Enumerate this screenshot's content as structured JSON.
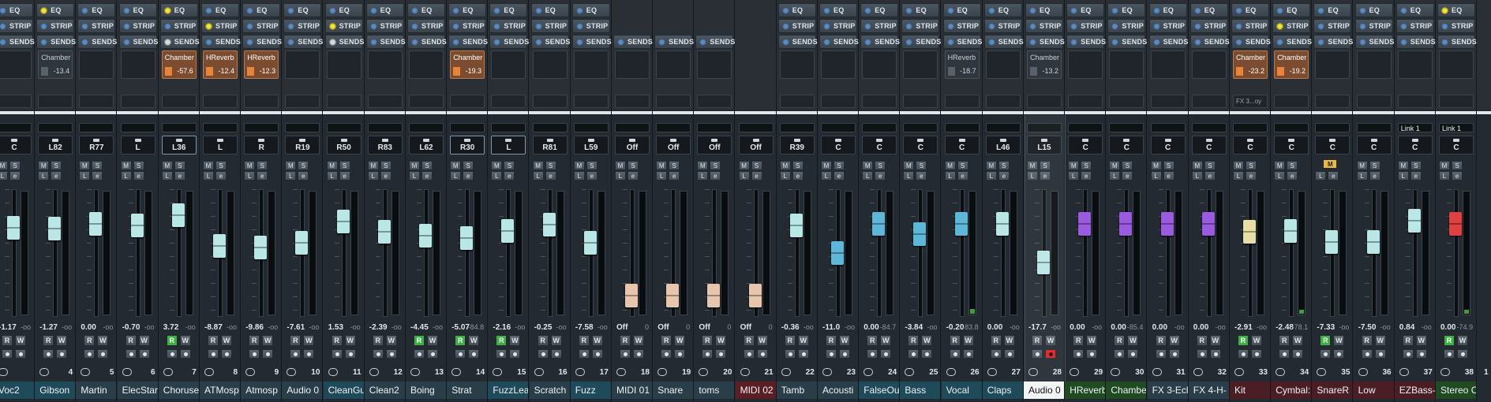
{
  "header_labels": {
    "eq": "EQ",
    "strip": "STRIP",
    "sends": "SENDS"
  },
  "channels": [
    {
      "eq": "blue",
      "strip": "blue",
      "sends": "blue",
      "send": null,
      "pan": "C",
      "rw": [
        "R",
        "W"
      ],
      "val": "-1.17",
      "peak": "-oo",
      "num": "",
      "name": "Voc2",
      "nameColor": "#1e4a5a",
      "faderColor": "#b9e7e6",
      "faderPos": 0.26
    },
    {
      "eq": "yellow",
      "strip": "blue",
      "sends": "blue",
      "send": {
        "name": "Chamber",
        "val": "-13.4",
        "style": "plain"
      },
      "pan": "L82",
      "val": "-1.27",
      "peak": "-oo",
      "num": "4",
      "name": "Gibson",
      "nameColor": "#1e4a5a",
      "faderColor": "#b9e7e6",
      "faderPos": 0.27
    },
    {
      "eq": "blue",
      "strip": "blue",
      "sends": "blue",
      "send": null,
      "pan": "R77",
      "val": "0.00",
      "peak": "-oo",
      "num": "5",
      "name": "Martin",
      "nameColor": "#2a3e4a",
      "faderColor": "#b9e7e6",
      "faderPos": 0.22
    },
    {
      "eq": "blue",
      "strip": "blue",
      "sends": "blue",
      "send": null,
      "pan": "L",
      "val": "-0.70",
      "peak": "-oo",
      "num": "6",
      "name": "ElecStar",
      "nameColor": "#2a3e4a",
      "faderColor": "#b9e7e6",
      "faderPos": 0.24
    },
    {
      "eq": "yellow",
      "strip": "blue",
      "sends": "off",
      "send": {
        "name": "Chamber",
        "val": "-57.6",
        "style": "orange"
      },
      "pan": "L36",
      "panSel": true,
      "val": "3.72",
      "peak": "-oo",
      "num": "7",
      "name": "Choruse",
      "nameColor": "#2a3e4a",
      "faderColor": "#b9e7e6",
      "faderPos": 0.14,
      "rOn": true
    },
    {
      "eq": "blue",
      "strip": "yellow",
      "sends": "blue",
      "send": {
        "name": "HReverb",
        "val": "-12.4",
        "style": "orange"
      },
      "pan": "L",
      "val": "-8.87",
      "peak": "-oo",
      "num": "8",
      "name": "ATMosp",
      "nameColor": "#2a3e4a",
      "faderColor": "#b9e7e6",
      "faderPos": 0.44
    },
    {
      "eq": "blue",
      "strip": "blue",
      "sends": "blue",
      "send": {
        "name": "HReverb",
        "val": "-12.3",
        "style": "orange"
      },
      "pan": "R",
      "val": "-9.86",
      "peak": "-oo",
      "num": "9",
      "name": "Atmosp",
      "nameColor": "#2a3e4a",
      "faderColor": "#b9e7e6",
      "faderPos": 0.45
    },
    {
      "eq": "blue",
      "strip": "blue",
      "sends": "blue",
      "send": null,
      "pan": "R19",
      "val": "-7.61",
      "peak": "-oo",
      "num": "10",
      "name": "Audio 0",
      "nameColor": "#2a3e4a",
      "faderColor": "#b9e7e6",
      "faderPos": 0.41
    },
    {
      "eq": "blue",
      "strip": "yellow",
      "sends": "off",
      "send": null,
      "pan": "R50",
      "val": "1.53",
      "peak": "-oo",
      "num": "11",
      "name": "CleanGu",
      "nameColor": "#1e4a5a",
      "faderColor": "#b9e7e6",
      "faderPos": 0.2
    },
    {
      "eq": "blue",
      "strip": "blue",
      "sends": "blue",
      "send": null,
      "pan": "R83",
      "val": "-2.39",
      "peak": "-oo",
      "num": "12",
      "name": "Clean2",
      "nameColor": "#2a3e4a",
      "faderColor": "#b9e7e6",
      "faderPos": 0.3
    },
    {
      "eq": "blue",
      "strip": "blue",
      "sends": "blue",
      "send": null,
      "pan": "L62",
      "val": "-4.45",
      "peak": "-oo",
      "num": "13",
      "name": "Boing",
      "nameColor": "#2a3e4a",
      "faderColor": "#b9e7e6",
      "faderPos": 0.34,
      "rOn": true
    },
    {
      "eq": "blue",
      "strip": "blue",
      "sends": "blue",
      "send": {
        "name": "Chamber",
        "val": "-19.3",
        "style": "orange"
      },
      "pan": "R30",
      "panSel": true,
      "val": "-5.07",
      "peak": "-84.8",
      "num": "14",
      "name": "Strat",
      "nameColor": "#2a3e4a",
      "faderColor": "#b9e7e6",
      "faderPos": 0.36,
      "rOn": true
    },
    {
      "eq": "blue",
      "strip": "blue",
      "sends": "blue",
      "send": null,
      "pan": "L",
      "panSel": true,
      "val": "-2.16",
      "peak": "-oo",
      "num": "15",
      "name": "FuzzLea",
      "nameColor": "#1e4a5a",
      "faderColor": "#b9e7e6",
      "faderPos": 0.29,
      "rOn": true
    },
    {
      "eq": "blue",
      "strip": "blue",
      "sends": "blue",
      "send": null,
      "pan": "R81",
      "val": "-0.25",
      "peak": "-oo",
      "num": "16",
      "name": "Scratch",
      "nameColor": "#2a3e4a",
      "faderColor": "#b9e7e6",
      "faderPos": 0.23
    },
    {
      "eq": "blue",
      "strip": "blue",
      "sends": "blue",
      "send": null,
      "pan": "L59",
      "val": "-7.58",
      "peak": "-oo",
      "num": "17",
      "name": "Fuzz",
      "nameColor": "#1e4a5a",
      "faderColor": "#b9e7e6",
      "faderPos": 0.41
    },
    {
      "eq": "",
      "strip": "",
      "sends": "blue",
      "send": null,
      "pan": "Off",
      "val": "Off",
      "peak": "0",
      "num": "18",
      "name": "MIDI 01",
      "nameColor": "#2a3e4a",
      "faderColor": "#e8c6ad",
      "faderPos": 0.92
    },
    {
      "eq": "",
      "strip": "",
      "sends": "blue",
      "send": null,
      "pan": "Off",
      "val": "Off",
      "peak": "0",
      "num": "19",
      "name": "Snare",
      "nameColor": "#2a3e4a",
      "faderColor": "#e8c6ad",
      "faderPos": 0.92
    },
    {
      "eq": "",
      "strip": "",
      "sends": "blue",
      "send": null,
      "pan": "Off",
      "val": "Off",
      "peak": "0",
      "num": "20",
      "name": "toms",
      "nameColor": "#2a3e4a",
      "faderColor": "#e8c6ad",
      "faderPos": 0.92
    },
    {
      "eq": "",
      "strip": "",
      "sends": "",
      "send": null,
      "pan": "Off",
      "val": "Off",
      "peak": "0",
      "num": "21",
      "name": "MIDI 02",
      "nameColor": "#5a1e24",
      "faderColor": "#e8c6ad",
      "faderPos": 0.92
    },
    {
      "eq": "blue",
      "strip": "blue",
      "sends": "blue",
      "send": null,
      "pan": "R39",
      "val": "-0.36",
      "peak": "-oo",
      "num": "22",
      "name": "Tamb",
      "nameColor": "#2a3e4a",
      "faderColor": "#b9e7e6",
      "faderPos": 0.24
    },
    {
      "eq": "blue",
      "strip": "blue",
      "sends": "blue",
      "send": null,
      "pan": "C",
      "val": "-11.0",
      "peak": "-oo",
      "num": "23",
      "name": "Acousti",
      "nameColor": "#2a3e4a",
      "faderColor": "#5db7d8",
      "faderPos": 0.51
    },
    {
      "eq": "blue",
      "strip": "blue",
      "sends": "blue",
      "send": null,
      "pan": "C",
      "val": "0.00",
      "peak": "-84.7",
      "num": "24",
      "name": "FalseOu",
      "nameColor": "#1e4a5a",
      "faderColor": "#5db7d8",
      "faderPos": 0.22
    },
    {
      "eq": "blue",
      "strip": "blue",
      "sends": "blue",
      "send": null,
      "pan": "C",
      "val": "-3.84",
      "peak": "-oo",
      "num": "25",
      "name": "Bass",
      "nameColor": "#1e4a5a",
      "faderColor": "#5db7d8",
      "faderPos": 0.32
    },
    {
      "eq": "blue",
      "strip": "blue",
      "sends": "blue",
      "send": {
        "name": "HReverb",
        "val": "-18.7",
        "style": "plain"
      },
      "pan": "C",
      "val": "-0.20",
      "peak": "-83.8",
      "num": "26",
      "name": "Vocal",
      "nameColor": "#1e4a5a",
      "faderColor": "#5db7d8",
      "faderPos": 0.22,
      "meter": 0.04
    },
    {
      "eq": "blue",
      "strip": "blue",
      "sends": "blue",
      "send": null,
      "pan": "L46",
      "val": "0.00",
      "peak": "-oo",
      "num": "27",
      "name": "Claps",
      "nameColor": "#1e4a5a",
      "faderColor": "#b9e7e6",
      "faderPos": 0.22
    },
    {
      "eq": "blue",
      "strip": "blue",
      "sends": "blue",
      "send": {
        "name": "Chamber",
        "val": "-13.2",
        "style": "plain"
      },
      "pan": "L15",
      "val": "-17.7",
      "peak": "-oo",
      "num": "28",
      "name": "Audio 0",
      "nameColor": "white",
      "faderColor": "#b9e7e6",
      "faderPos": 0.6,
      "recOn": true,
      "selected": true
    },
    {
      "eq": "blue",
      "strip": "blue",
      "sends": "blue",
      "send": null,
      "pan": "C",
      "val": "0.00",
      "peak": "-oo",
      "num": "29",
      "name": "HReverb",
      "nameColor": "#1f4a22",
      "faderColor": "#9a5be0",
      "faderPos": 0.22
    },
    {
      "eq": "blue",
      "strip": "blue",
      "sends": "blue",
      "send": null,
      "pan": "C",
      "val": "0.00",
      "peak": "-85.4",
      "num": "30",
      "name": "Chambe",
      "nameColor": "#1f4a22",
      "faderColor": "#9a5be0",
      "faderPos": 0.22
    },
    {
      "eq": "blue",
      "strip": "blue",
      "sends": "blue",
      "send": null,
      "pan": "C",
      "val": "0.00",
      "peak": "-oo",
      "num": "31",
      "name": "FX 3-Ecl",
      "nameColor": "#2a3e4a",
      "faderColor": "#9a5be0",
      "faderPos": 0.22
    },
    {
      "eq": "blue",
      "strip": "blue",
      "sends": "blue",
      "send": null,
      "pan": "C",
      "val": "0.00",
      "peak": "-oo",
      "num": "32",
      "name": "FX 4-H-",
      "nameColor": "#2a3e4a",
      "faderColor": "#9a5be0",
      "faderPos": 0.22
    },
    {
      "eq": "blue",
      "strip": "blue",
      "sends": "blue",
      "send": {
        "name": "Chamber",
        "val": "-23.2",
        "style": "orange"
      },
      "slotText": "FX 3...oy",
      "pan": "C",
      "val": "-2.91",
      "peak": "-oo",
      "num": "33",
      "name": "Kit",
      "nameColor": "#4a1e24",
      "faderColor": "#e6e0a8",
      "faderPos": 0.3,
      "rOn": true
    },
    {
      "eq": "blue",
      "strip": "yellow",
      "sends": "blue",
      "send": {
        "name": "Chamber",
        "val": "-19.2",
        "style": "orange"
      },
      "pan": "C",
      "val": "-2.48",
      "peak": "-78.1",
      "num": "34",
      "name": "Cymbal:",
      "nameColor": "#4a1e24",
      "faderColor": "#b9e7e6",
      "faderPos": 0.29,
      "meter": 0.03
    },
    {
      "eq": "blue",
      "strip": "blue",
      "sends": "blue",
      "send": null,
      "pan": "C",
      "val": "-7.33",
      "peak": "-oo",
      "num": "35",
      "name": "SnareR",
      "nameColor": "#4a1e24",
      "faderColor": "#b9e7e6",
      "faderPos": 0.4,
      "soloOn": true,
      "rOn": true
    },
    {
      "eq": "blue",
      "strip": "blue",
      "sends": "blue",
      "send": null,
      "pan": "C",
      "val": "-7.50",
      "peak": "-oo",
      "num": "36",
      "name": "Low",
      "nameColor": "#4a1e24",
      "faderColor": "#b9e7e6",
      "faderPos": 0.4
    },
    {
      "eq": "blue",
      "strip": "blue",
      "sends": "blue",
      "send": null,
      "pan": "C",
      "link": "Link 1",
      "val": "0.84",
      "peak": "-oo",
      "num": "37",
      "name": "EZBass-",
      "nameColor": "#4a1e24",
      "faderColor": "#b9e7e6",
      "faderPos": 0.19
    },
    {
      "eq": "yellow",
      "strip": "blue",
      "sends": "blue",
      "send": null,
      "pan": "C",
      "link": "Link 1",
      "val": "0.00",
      "peak": "-74.9",
      "num": "38",
      "name": "Stereo C",
      "nameColor": "#1f4a22",
      "faderColor": "#e04040",
      "faderPos": 0.22,
      "meter": 0.03,
      "rOn": true
    }
  ],
  "row_labels": {
    "m": "M",
    "s": "S",
    "l": "L",
    "e": "e",
    "r": "R",
    "w": "W"
  },
  "misc": {
    "corner_num": "1"
  }
}
